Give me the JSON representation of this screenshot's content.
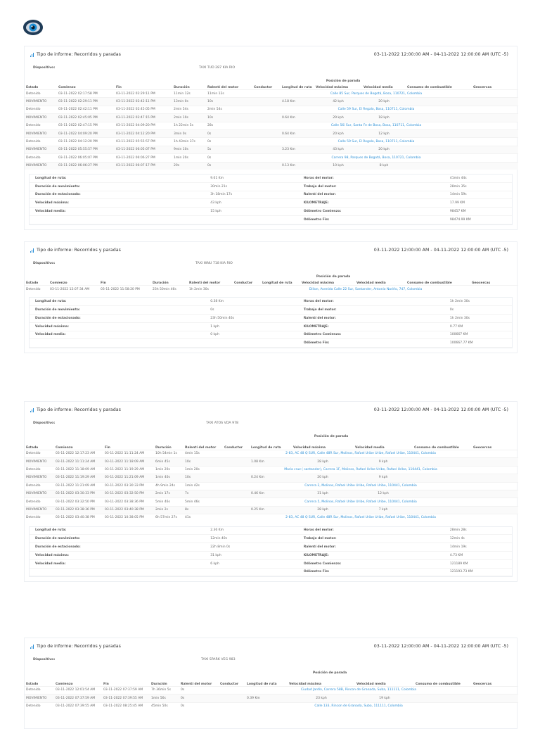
{
  "reports": [
    {
      "title": "Tipo de informe: Recorridos y paradas",
      "date_range": "03-11-2022 12:00:00 AM - 04-11-2022 12:00:00 AM (UTC -5)",
      "device_label": "Dispositivo:",
      "device_value": "TAXI TUD 287 KIA RIO",
      "group_header": "Posición de parada",
      "columns": [
        "Estado",
        "Comienzo",
        "Fin",
        "Duración",
        "Ralentí del motor",
        "Conductor",
        "Longitud de ruta",
        "Velocidad máxima",
        "Velocidad media",
        "Consumo de combustible",
        "Geocercas"
      ],
      "rows": [
        {
          "estado": "Detenido",
          "comienzo": "03-11-2022 02:17:58 PM",
          "fin": "03-11-2022 02:29:11 PM",
          "duracion": "11min 12s",
          "ralenti": "11min 12s",
          "conductor": "",
          "pos": "Calle 85 Sur, Parques de Bogotá, Bosa, 110721, Colombia"
        },
        {
          "estado": "MOVIMIENTO",
          "comienzo": "03-11-2022 02:29:11 PM",
          "fin": "03-11-2022 02:42:11 PM",
          "duracion": "13min 0s",
          "ralenti": "10s",
          "conductor": "",
          "longitud": "4.18 Km",
          "vmax": "42 kph",
          "vmed": "20 kph"
        },
        {
          "estado": "Detenido",
          "comienzo": "03-11-2022 02:42:11 PM",
          "fin": "03-11-2022 02:45:05 PM",
          "duracion": "2min 54s",
          "ralenti": "2min 54s",
          "conductor": "",
          "pos": "Calle 59 Sur, El Regalo, Bosa, 110711, Colombia"
        },
        {
          "estado": "MOVIMIENTO",
          "comienzo": "03-11-2022 02:45:05 PM",
          "fin": "03-11-2022 02:47:15 PM",
          "duracion": "2min 10s",
          "ralenti": "10s",
          "conductor": "",
          "longitud": "0.64 Km",
          "vmax": "29 kph",
          "vmed": "18 kph"
        },
        {
          "estado": "Detenido",
          "comienzo": "03-11-2022 02:47:15 PM",
          "fin": "03-11-2022 04:09:20 PM",
          "duracion": "1h 22min 5s",
          "ralenti": "28s",
          "conductor": "",
          "pos": "Calle 56i Sur, Santa Fe de Bosa, Bosa, 110711, Colombia"
        },
        {
          "estado": "MOVIMIENTO",
          "comienzo": "03-11-2022 04:09:20 PM",
          "fin": "03-11-2022 04:12:20 PM",
          "duracion": "3min 0s",
          "ralenti": "0s",
          "conductor": "",
          "longitud": "0.64 Km",
          "vmax": "20 kph",
          "vmed": "12 kph"
        },
        {
          "estado": "Detenido",
          "comienzo": "03-11-2022 04:12:20 PM",
          "fin": "03-11-2022 05:55:57 PM",
          "duracion": "1h 43min 37s",
          "ralenti": "0s",
          "conductor": "",
          "pos": "Calle 59 Sur, El Regalo, Bosa, 110711, Colombia"
        },
        {
          "estado": "MOVIMIENTO",
          "comienzo": "03-11-2022 05:55:57 PM",
          "fin": "03-11-2022 06:05:07 PM",
          "duracion": "9min 10s",
          "ralenti": "5s",
          "conductor": "",
          "longitud": "3.23 Km",
          "vmax": "43 kph",
          "vmed": "20 kph"
        },
        {
          "estado": "Detenido",
          "comienzo": "03-11-2022 06:05:07 PM",
          "fin": "03-11-2022 06:06:27 PM",
          "duracion": "1min 20s",
          "ralenti": "0s",
          "conductor": "",
          "pos": "Carrera 98, Parques de Bogotá, Bosa, 110721, Colombia"
        },
        {
          "estado": "MOVIMIENTO",
          "comienzo": "03-11-2022 06:06:27 PM",
          "fin": "03-11-2022 06:07:17 PM",
          "duracion": "20s",
          "ralenti": "0s",
          "conductor": "",
          "longitud": "0.13 Km",
          "vmax": "10 kph",
          "vmed": "8 kph"
        }
      ],
      "summary_left": [
        {
          "k": "Longitud de ruta:",
          "v": "9.01 Km"
        },
        {
          "k": "Duración de movimiento:",
          "v": "30min 21s"
        },
        {
          "k": "Duración de estacionado:",
          "v": "3h 18min 17s"
        },
        {
          "k": "Velocidad máxima:",
          "v": "43 kph"
        },
        {
          "k": "Velocidad media:",
          "v": "15 kph"
        }
      ],
      "summary_right": [
        {
          "k": "Horas del motor:",
          "v": "41min 44s"
        },
        {
          "k": "Trabajo del motor:",
          "v": "28min 35s"
        },
        {
          "k": "Ralentí del motor:",
          "v": "14min 59s"
        },
        {
          "k": "KILOMETRAJE:",
          "v": "17.99 KM"
        },
        {
          "k": "Odómetro Comienzo:",
          "v": "98457 KM"
        },
        {
          "k": "Odómetro Fin:",
          "v": "98474.99 KM"
        }
      ]
    },
    {
      "title": "Tipo de informe: Recorridos y paradas",
      "date_range": "03-11-2022 12:00:00 AM - 04-11-2022 12:00:00 AM (UTC -5)",
      "device_label": "Dispositivo:",
      "device_value": "TAXI WNU 718 KIA RIO",
      "group_header": "Posición de parada",
      "columns": [
        "Estado",
        "Comienzo",
        "Fin",
        "Duración",
        "Ralentí del motor",
        "Conductor",
        "Longitud de ruta",
        "Velocidad máxima",
        "Velocidad media",
        "Consumo de combustible",
        "Geocercas"
      ],
      "rows": [
        {
          "estado": "Detenido",
          "comienzo": "03-11-2022 12:07:34 AM",
          "fin": "03-11-2022 11:58:20 PM",
          "duracion": "23h 50min 46s",
          "ralenti": "1h 2min 30s",
          "conductor": "",
          "pos": "Dilion, Avenida Calle 22 Sur, Santander, Antonio Nariño, 747, Colombia"
        }
      ],
      "summary_left": [
        {
          "k": "Longitud de ruta:",
          "v": "0.38 Km"
        },
        {
          "k": "Duración de movimiento:",
          "v": "0s"
        },
        {
          "k": "Duración de estacionado:",
          "v": "23h 50min 46s"
        },
        {
          "k": "Velocidad máxima:",
          "v": "1 kph"
        },
        {
          "k": "Velocidad media:",
          "v": "0 kph"
        }
      ],
      "summary_right": [
        {
          "k": "Horas del motor:",
          "v": "1h 2min 30s"
        },
        {
          "k": "Trabajo del motor:",
          "v": "0s"
        },
        {
          "k": "Ralentí del motor:",
          "v": "1h 2min 30s"
        },
        {
          "k": "KILOMETRAJE:",
          "v": "0.77 KM"
        },
        {
          "k": "Odómetro Comienzo:",
          "v": "100667 KM"
        },
        {
          "k": "Odómetro Fin:",
          "v": "100667.77 KM"
        }
      ]
    },
    {
      "title": "Tipo de informe: Recorridos y paradas",
      "date_range": "03-11-2022 12:00:00 AM - 04-11-2022 12:00:00 AM (UTC -5)",
      "device_label": "Dispositivo:",
      "device_value": "TAXI ATOS VDA 978",
      "group_header": "Posición de parada",
      "columns": [
        "Estado",
        "Comienzo",
        "Fin",
        "Duración",
        "Ralentí del motor",
        "Conductor",
        "Longitud de ruta",
        "Velocidad máxima",
        "Velocidad media",
        "Consumo de combustible",
        "Geocercas"
      ],
      "rows": [
        {
          "estado": "Detenido",
          "comienzo": "03-11-2022 12:17:23 AM",
          "fin": "03-11-2022 11:11:24 AM",
          "duracion": "10h 54min 1s",
          "ralenti": "4min 15s",
          "conductor": "",
          "pos": "2-83, AC 48 Q SUR, Calle 48R Sur, Molinos, Rafael Uribe Uribe, Rafael Uribe, 110441, Colombia"
        },
        {
          "estado": "MOVIMIENTO",
          "comienzo": "03-11-2022 11:11:24 AM",
          "fin": "03-11-2022 11:18:09 AM",
          "duracion": "6min 45s",
          "ralenti": "10s",
          "conductor": "",
          "longitud": "1.08 Km",
          "vmax": "28 kph",
          "vmed": "9 kph"
        },
        {
          "estado": "Detenido",
          "comienzo": "03-11-2022 11:18:09 AM",
          "fin": "03-11-2022 11:19:29 AM",
          "duracion": "1min 20s",
          "ralenti": "1min 20s",
          "conductor": "",
          "pos": "Maria cruz ( santander), Carrera 1F, Molinos, Rafael Uribe Uribe, Rafael Uribe, 110441, Colombia"
        },
        {
          "estado": "MOVIMIENTO",
          "comienzo": "03-11-2022 11:19:29 AM",
          "fin": "03-11-2022 11:21:09 AM",
          "duracion": "1min 40s",
          "ralenti": "10s",
          "conductor": "",
          "longitud": "0.24 Km",
          "vmax": "20 kph",
          "vmed": "9 kph"
        },
        {
          "estado": "Detenido",
          "comienzo": "03-11-2022 11:21:09 AM",
          "fin": "03-11-2022 03:30:33 PM",
          "duracion": "4h 9min 24s",
          "ralenti": "1min 42s",
          "conductor": "",
          "pos": "Carrera 2, Molinos, Rafael Uribe Uribe, Rafael Uribe, 110441, Colombia"
        },
        {
          "estado": "MOVIMIENTO",
          "comienzo": "03-11-2022 03:30:33 PM",
          "fin": "03-11-2022 03:32:50 PM",
          "duracion": "2min 17s",
          "ralenti": "7s",
          "conductor": "",
          "longitud": "0.46 Km",
          "vmax": "31 kph",
          "vmed": "12 kph"
        },
        {
          "estado": "Detenido",
          "comienzo": "03-11-2022 03:32:50 PM",
          "fin": "03-11-2022 03:38:36 PM",
          "duracion": "5min 46s",
          "ralenti": "5min 46s",
          "conductor": "",
          "pos": "Carrera 5, Molinos, Rafael Uribe Uribe, Rafael Uribe, 110441, Colombia"
        },
        {
          "estado": "MOVIMIENTO",
          "comienzo": "03-11-2022 03:38:36 PM",
          "fin": "03-11-2022 03:40:38 PM",
          "duracion": "2min 2s",
          "ralenti": "8s",
          "conductor": "",
          "longitud": "0.25 Km",
          "vmax": "28 kph",
          "vmed": "7 kph"
        },
        {
          "estado": "Detenido",
          "comienzo": "03-11-2022 03:40:38 PM",
          "fin": "03-11-2022 10:38:05 PM",
          "duracion": "6h 57min 27s",
          "ralenti": "41s",
          "conductor": "",
          "pos": "2-83, AC 48 Q SUR, Calle 48R Sur, Molinos, Rafael Uribe Uribe, Rafael Uribe, 110441, Colombia"
        }
      ],
      "summary_left": [
        {
          "k": "Longitud de ruta:",
          "v": "2.36 Km"
        },
        {
          "k": "Duración de movimiento:",
          "v": "12min 40s"
        },
        {
          "k": "Duración de estacionado:",
          "v": "22h 8min 0s"
        },
        {
          "k": "Velocidad máxima:",
          "v": "31 kph"
        },
        {
          "k": "Velocidad media:",
          "v": "6 kph"
        }
      ],
      "summary_right": [
        {
          "k": "Horas del motor:",
          "v": "28min 28s"
        },
        {
          "k": "Trabajo del motor:",
          "v": "12min 4s"
        },
        {
          "k": "Ralentí del motor:",
          "v": "14min 19s"
        },
        {
          "k": "KILOMETRAJE:",
          "v": "4.73 KM"
        },
        {
          "k": "Odómetro Comienzo:",
          "v": "121189 KM"
        },
        {
          "k": "Odómetro Fin:",
          "v": "121193.73 KM"
        }
      ]
    },
    {
      "title": "Tipo de informe: Recorridos y paradas",
      "date_range": "03-11-2022 12:00:00 AM - 04-11-2022 12:00:00 AM (UTC -5)",
      "device_label": "Dispositivo:",
      "device_value": "TAXI SPARK VEG 983",
      "group_header": "Posición de parada",
      "columns": [
        "Estado",
        "Comienzo",
        "Fin",
        "Duración",
        "Ralentí del motor",
        "Conductor",
        "Longitud de ruta",
        "Velocidad máxima",
        "Velocidad media",
        "Consumo de combustible",
        "Geocercas"
      ],
      "rows": [
        {
          "estado": "Detenido",
          "comienzo": "03-11-2022 12:01:54 AM",
          "fin": "03-11-2022 07:37:59 AM",
          "duracion": "7h 36min 5s",
          "ralenti": "0s",
          "conductor": "",
          "pos": "Ciudad Jardín, Carrera 58B, Rincon de Granada, Suba, 111111, Colombia"
        },
        {
          "estado": "MOVIMIENTO",
          "comienzo": "03-11-2022 07:37:59 AM",
          "fin": "03-11-2022 07:39:55 AM",
          "duracion": "1min 56s",
          "ralenti": "0s",
          "conductor": "",
          "longitud": "0.39 Km",
          "vmax": "23 kph",
          "vmed": "19 kph"
        },
        {
          "estado": "Detenido",
          "comienzo": "03-11-2022 07:39:55 AM",
          "fin": "03-11-2022 08:25:45 AM",
          "duracion": "45min 50s",
          "ralenti": "0s",
          "conductor": "",
          "pos": "Calle 133, Rincon de Granada, Suba, 111111, Colombia"
        }
      ]
    }
  ]
}
